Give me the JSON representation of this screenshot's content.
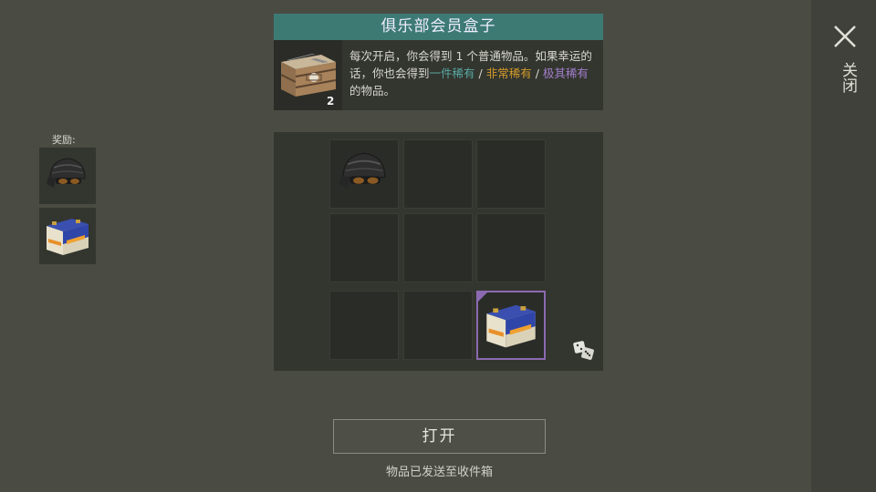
{
  "close": {
    "label": "关闭",
    "icon": "close-icon"
  },
  "box": {
    "title": "俱乐部会员盒子",
    "count": "2",
    "description": {
      "part1": "每次开启，你会得到 1 个普通物品。如果幸运的话，你也会得到",
      "rare": "一件稀有",
      "sep1": " / ",
      "very_rare": "非常稀有",
      "sep2": " / ",
      "extremely_rare": "极其稀有",
      "part2": "的物品。"
    }
  },
  "rewards": {
    "label": "奖励:",
    "items": [
      {
        "icon": "helmet-with-goggles-icon"
      },
      {
        "icon": "car-battery-icon"
      }
    ]
  },
  "grid": {
    "cells": [
      {
        "item": "helmet-with-goggles-icon",
        "rarity": ""
      },
      {
        "item": "",
        "rarity": ""
      },
      {
        "item": "",
        "rarity": ""
      },
      {
        "item": "",
        "rarity": ""
      },
      {
        "item": "",
        "rarity": ""
      },
      {
        "item": "",
        "rarity": ""
      },
      {
        "item": "",
        "rarity": ""
      },
      {
        "item": "",
        "rarity": ""
      },
      {
        "item": "car-battery-icon",
        "rarity": "rare"
      }
    ],
    "dice_icon": "dice-icon"
  },
  "open_button": {
    "label": "打开"
  },
  "status": {
    "text": "物品已发送至收件箱"
  },
  "colors": {
    "title_bar": "#3d7a74",
    "rare": "#58a8a2",
    "very_rare": "#d19a2a",
    "extremely_rare": "#a27ecb",
    "rare_border": "#8b6ab1"
  }
}
